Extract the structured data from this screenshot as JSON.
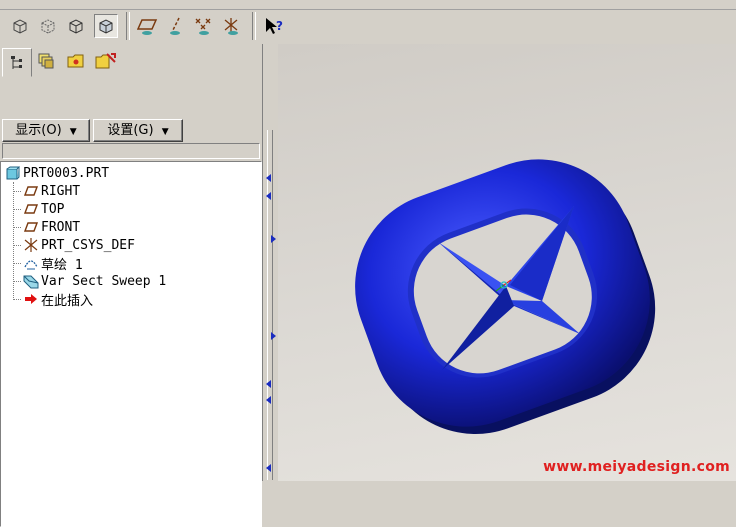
{
  "toolbar": {
    "view_icons": [
      "no-hidden-icon",
      "hidden-line-icon",
      "wireframe-icon",
      "shaded-icon"
    ],
    "datum_icons": [
      "datum-plane-icon",
      "datum-axis-icon",
      "datum-point-icon",
      "coordinate-system-icon"
    ],
    "help_icon": "context-help-icon"
  },
  "panel": {
    "tabs": [
      "model-tree-tab",
      "layers-tab",
      "folder-browser-tab",
      "favorites-tab"
    ],
    "show_menu": "显示(O)",
    "settings_menu": "设置(G)"
  },
  "tree": {
    "root": "PRT0003.PRT",
    "items": [
      {
        "label": "RIGHT",
        "icon": "datum-plane-icon"
      },
      {
        "label": "TOP",
        "icon": "datum-plane-icon"
      },
      {
        "label": "FRONT",
        "icon": "datum-plane-icon"
      },
      {
        "label": "PRT_CSYS_DEF",
        "icon": "coordinate-system-icon"
      },
      {
        "label": "草绘 1",
        "icon": "sketch-icon"
      },
      {
        "label": "Var Sect Sweep 1",
        "icon": "sweep-feature-icon"
      },
      {
        "label": "在此插入",
        "icon": "insert-here-arrow-icon"
      }
    ]
  },
  "viewport": {
    "model_color": "#1a28d8",
    "watermark": "www.meiyadesign.com"
  }
}
